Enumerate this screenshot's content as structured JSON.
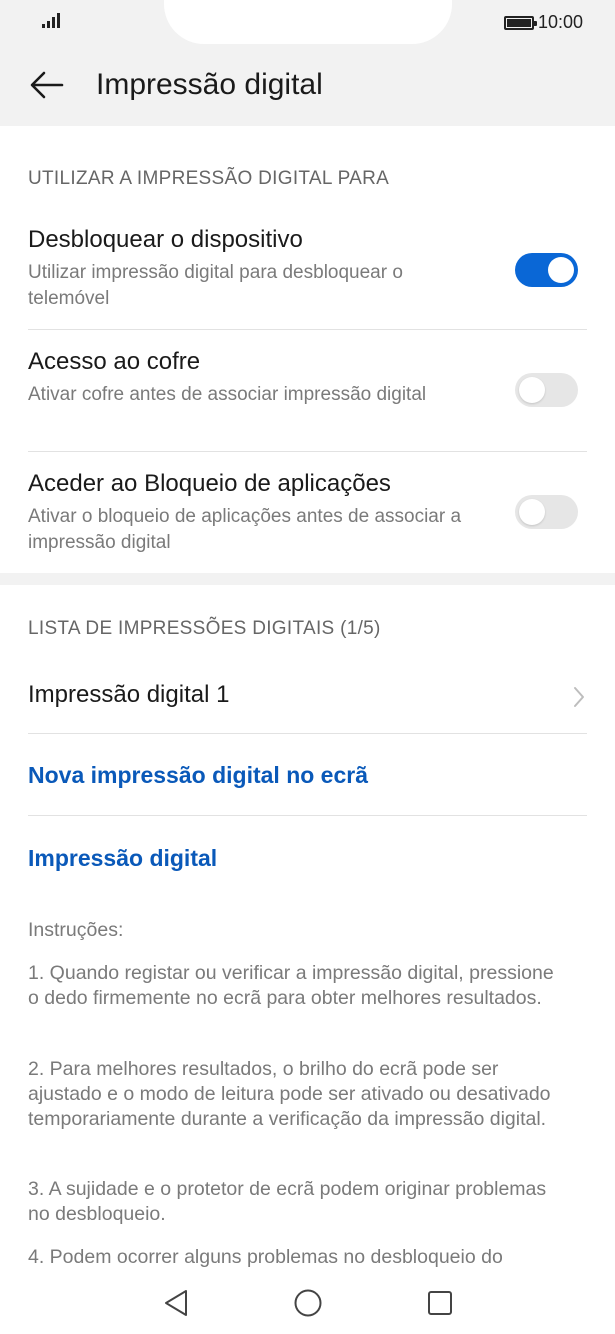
{
  "status": {
    "time": "10:00"
  },
  "header": {
    "title": "Impressão digital"
  },
  "section1": {
    "heading": "UTILIZAR A IMPRESSÃO DIGITAL PARA",
    "items": [
      {
        "title": "Desbloquear o dispositivo",
        "subtitle": "Utilizar impressão digital para desbloquear o telemóvel",
        "enabled": true
      },
      {
        "title": "Acesso ao cofre",
        "subtitle": "Ativar cofre antes de associar impressão digital",
        "enabled": false
      },
      {
        "title": "Aceder ao Bloqueio de aplicações",
        "subtitle": "Ativar o bloqueio de aplicações antes de associar a impressão digital",
        "enabled": false
      }
    ]
  },
  "section2": {
    "heading": "LISTA DE IMPRESSÕES DIGITAIS (1/5)",
    "fingerprint_item": "Impressão digital 1",
    "new_fingerprint": "Nova impressão digital no ecrã",
    "fingerprint_link": "Impressão digital"
  },
  "instructions": {
    "label": "Instruções:",
    "steps": [
      "1. Quando registar ou verificar a impressão digital, pressione o dedo firmemente no ecrã para obter melhores resultados.",
      "2. Para melhores resultados, o brilho do ecrã pode ser ajustado e o modo de leitura pode ser ativado ou desativado temporariamente durante a verificação da impressão digital.",
      "3. A sujidade e o protetor de ecrã podem originar problemas no desbloqueio.",
      "4. Podem ocorrer alguns problemas no desbloqueio do"
    ]
  },
  "colors": {
    "accent": "#0a67d6",
    "link": "#0a59b9",
    "toggle_off": "#e6e6e6"
  },
  "icons": {
    "back": "arrow-left-icon",
    "chevron": "chevron-right-icon",
    "nav_back": "triangle-back-icon",
    "nav_home": "circle-home-icon",
    "nav_recent": "square-recent-icon"
  }
}
